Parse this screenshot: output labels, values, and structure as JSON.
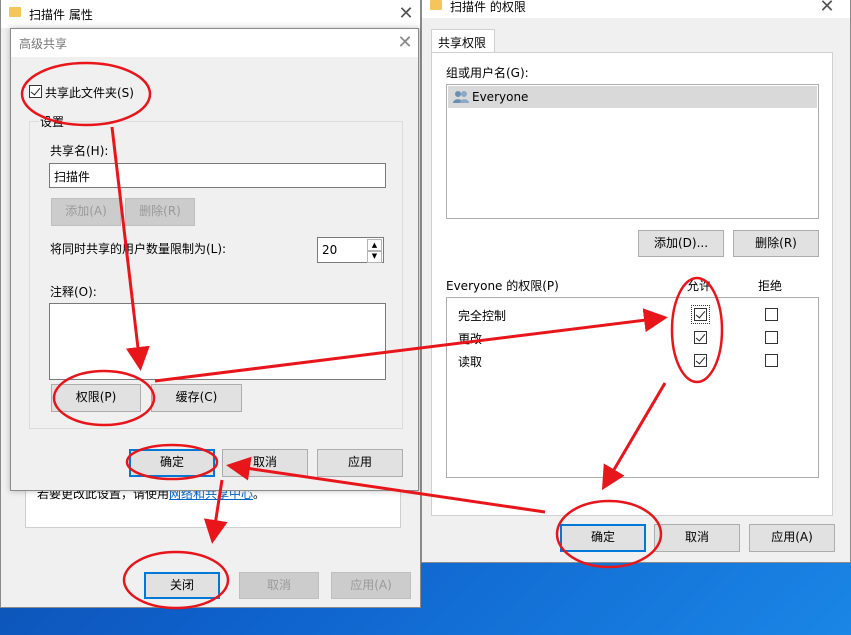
{
  "props_window": {
    "title": "扫描件 属性",
    "partial_text": "若要更改此设置，请使用",
    "partial_link": "网络和共享中心",
    "partial_end": "。",
    "buttons": {
      "close": "关闭",
      "cancel": "取消",
      "apply": "应用(A)"
    }
  },
  "advanced_share": {
    "title": "高级共享",
    "share_checkbox_label": "共享此文件夹(S)",
    "settings_label": "设置",
    "share_name_label": "共享名(H):",
    "share_name_value": "扫描件",
    "add_button": "添加(A)",
    "remove_button": "删除(R)",
    "limit_label": "将同时共享的用户数量限制为(L):",
    "limit_value": "20",
    "comment_label": "注释(O):",
    "permissions_button": "权限(P)",
    "cache_button": "缓存(C)",
    "ok_button": "确定",
    "cancel_button": "取消",
    "apply_button": "应用"
  },
  "permissions": {
    "title": "扫描件 的权限",
    "tab": "共享权限",
    "group_label": "组或用户名(G):",
    "users": [
      "Everyone"
    ],
    "add_button": "添加(D)...",
    "remove_button": "删除(R)",
    "perm_header": "Everyone 的权限(P)",
    "allow_header": "允许",
    "deny_header": "拒绝",
    "rows": [
      {
        "name": "完全控制",
        "allow": true,
        "deny": false
      },
      {
        "name": "更改",
        "allow": true,
        "deny": false
      },
      {
        "name": "读取",
        "allow": true,
        "deny": false
      }
    ],
    "ok_button": "确定",
    "cancel_button": "取消",
    "apply_button": "应用(A)"
  },
  "colors": {
    "annotation": "#e8161b",
    "accent": "#0078d7",
    "desktop": "#0e5fc9"
  }
}
